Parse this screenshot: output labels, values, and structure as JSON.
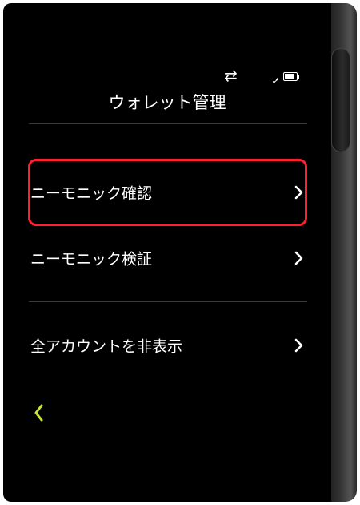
{
  "status_bar": {
    "sync_icon": "sync-arrows-icon",
    "wifi_icon": "wifi-icon",
    "battery_icon": "battery-icon"
  },
  "header": {
    "title": "ウォレット管理"
  },
  "menu": {
    "items": [
      {
        "label": "ニーモニック確認",
        "icon": "chevron-right-icon",
        "highlighted": true
      },
      {
        "label": "ニーモニック検証",
        "icon": "chevron-right-icon"
      },
      {
        "label": "全アカウントを非表示",
        "icon": "chevron-right-icon"
      }
    ]
  },
  "footer": {
    "back_icon": "chevron-left-icon"
  },
  "colors": {
    "background": "#000000",
    "text": "#ffffff",
    "highlight_border": "#ff1f2e",
    "back_accent": "#c8e63a",
    "divider": "#3a3a3a"
  }
}
